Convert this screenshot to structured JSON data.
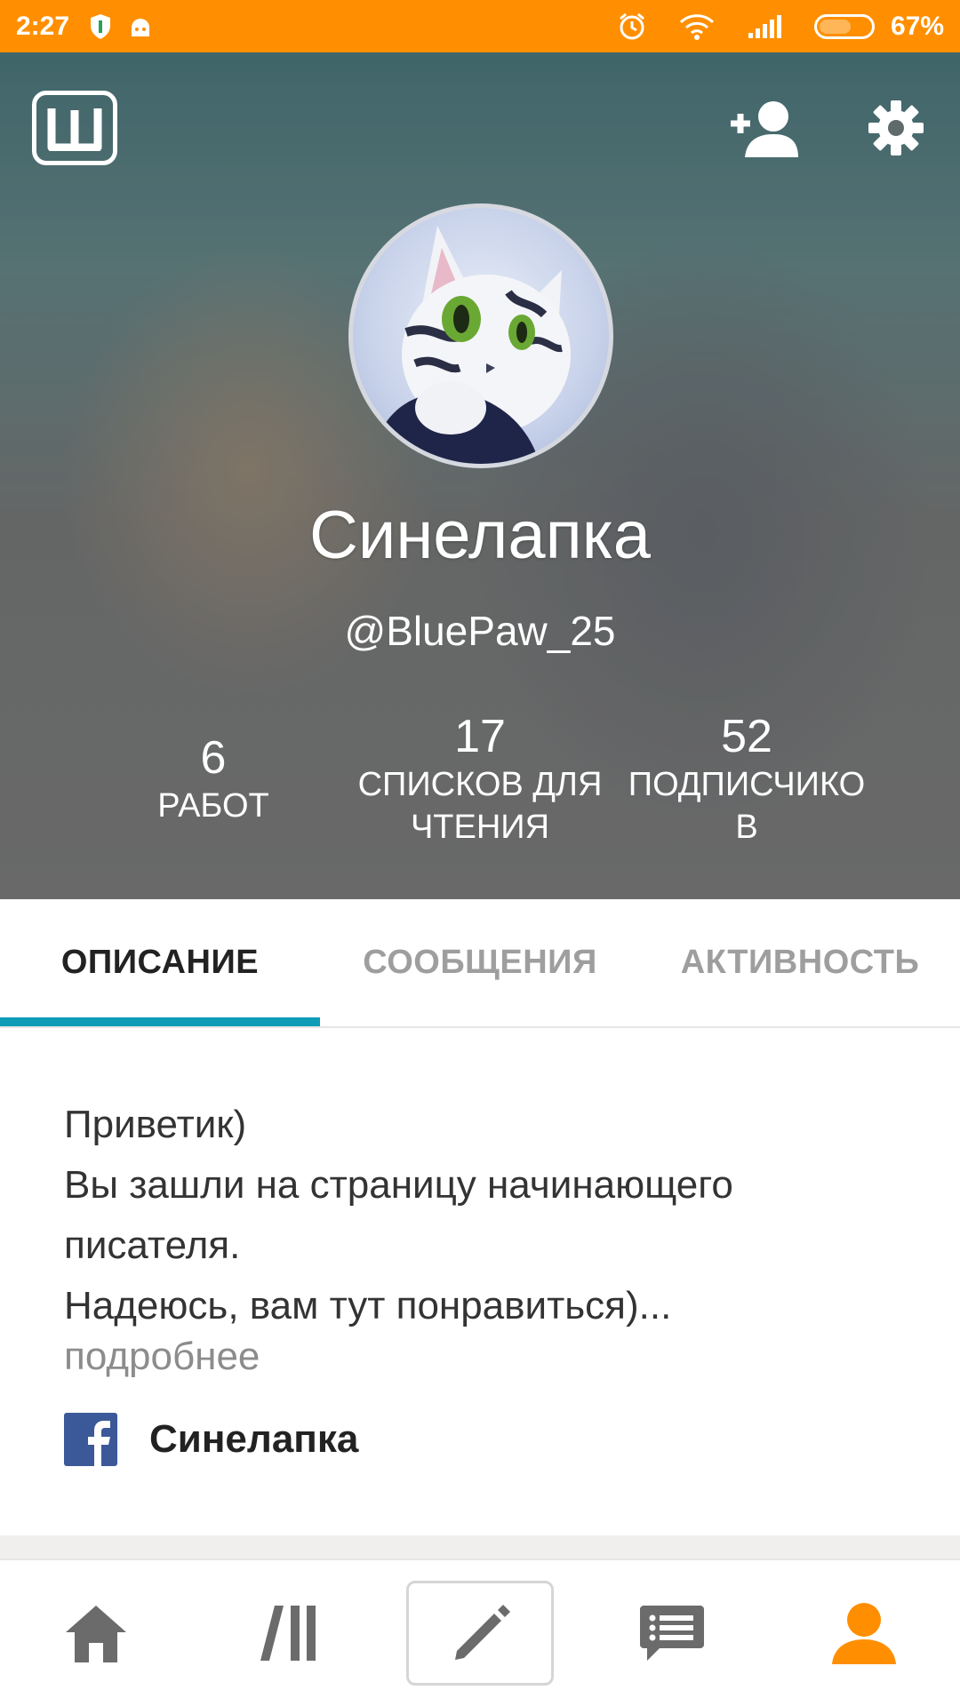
{
  "status_bar": {
    "time": "2:27",
    "battery_text": "67%",
    "battery_level": 0.67,
    "icons": [
      "shield-icon",
      "android-icon",
      "alarm-icon",
      "wifi-icon",
      "signal-icon",
      "battery-icon"
    ]
  },
  "header": {
    "logo_icon": "wattpad-logo",
    "add_user_icon": "add-user-icon",
    "settings_icon": "gear-icon"
  },
  "profile": {
    "name": "Синелапка",
    "username": "@BluePaw_25",
    "stats": [
      {
        "value": "6",
        "label_lines": [
          "РАБОТ"
        ]
      },
      {
        "value": "17",
        "label_lines": [
          "СПИСКОВ ДЛЯ",
          "ЧТЕНИЯ"
        ]
      },
      {
        "value": "52",
        "label_lines": [
          "ПОДПИСЧИКО",
          "В"
        ]
      }
    ]
  },
  "tabs": [
    {
      "label": "ОПИСАНИЕ",
      "active": true
    },
    {
      "label": "СООБЩЕНИЯ",
      "active": false
    },
    {
      "label": "АКТИВНОСТЬ",
      "active": false
    }
  ],
  "description": {
    "lines": [
      "Приветик)",
      "Вы зашли на страницу начинающего",
      "писателя.",
      "Надеюсь, вам тут понравиться)..."
    ],
    "more_link": "подробнее",
    "facebook_name": "Синелапка"
  },
  "bottom_nav": [
    {
      "name": "home-icon",
      "active": false
    },
    {
      "name": "library-icon",
      "active": false
    },
    {
      "name": "write-icon",
      "active": false
    },
    {
      "name": "messages-icon",
      "active": false
    },
    {
      "name": "profile-icon",
      "active": true
    }
  ],
  "colors": {
    "status_bar": "#ff8f00",
    "tab_indicator": "#0e9cb8",
    "nav_inactive": "#6b6b6b",
    "nav_active": "#ff8f00",
    "facebook": "#3b5998"
  }
}
